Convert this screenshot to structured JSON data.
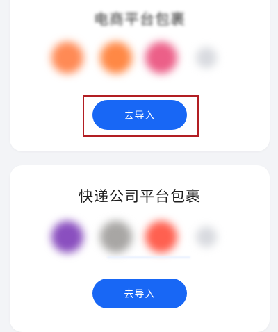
{
  "cards": [
    {
      "title": "电商平台包裹",
      "logos": [
        {
          "icon": "platform-logo-icon",
          "color": "#ff8a55"
        },
        {
          "icon": "platform-logo-icon",
          "color": "#ff8845"
        },
        {
          "icon": "platform-logo-icon",
          "color": "#ec5f88"
        },
        {
          "icon": "platform-logo-icon",
          "color": "#d8dadf"
        }
      ],
      "button_label": "去导入"
    },
    {
      "title": "快递公司平台包裹",
      "logos": [
        {
          "icon": "courier-logo-icon",
          "color": "#8a4fbf"
        },
        {
          "icon": "courier-logo-icon",
          "color": "#a8a6a4"
        },
        {
          "icon": "courier-logo-icon",
          "color": "#ff6050"
        },
        {
          "icon": "courier-logo-icon",
          "color": "#d8dadf"
        }
      ],
      "button_label": "去导入"
    }
  ],
  "colors": {
    "accent": "#1867f5",
    "highlight_border": "#b21e23",
    "background": "#f3f4f7"
  }
}
